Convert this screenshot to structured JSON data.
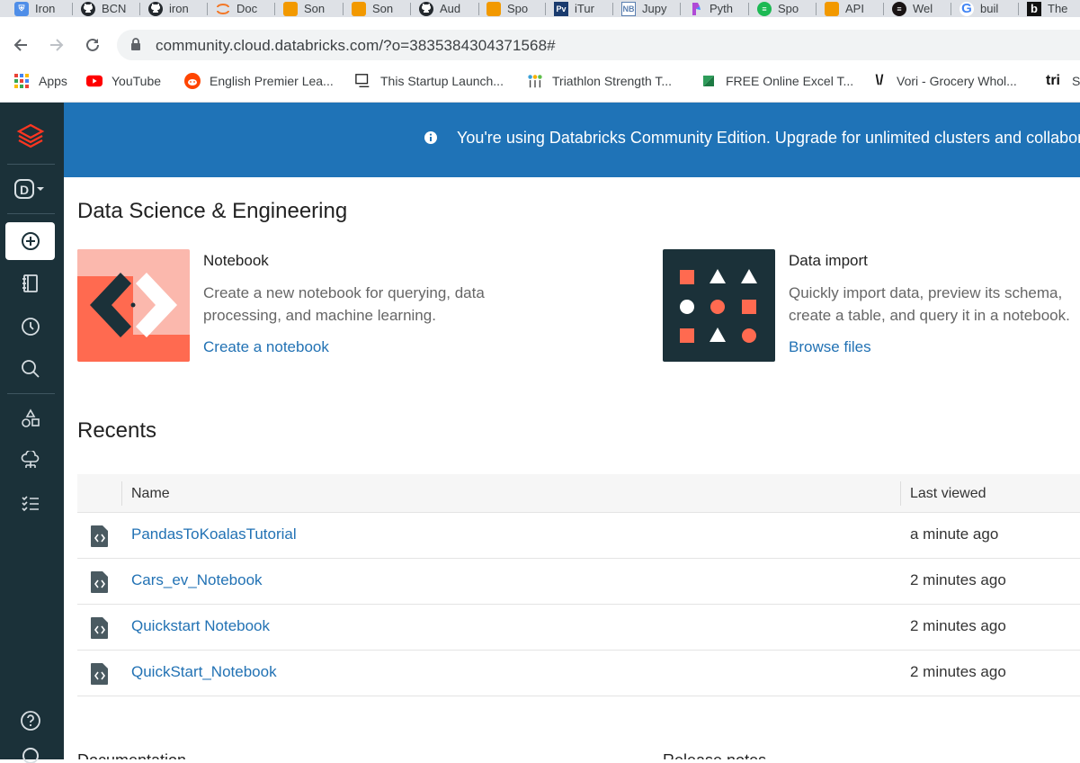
{
  "browser": {
    "tabs": [
      {
        "label": "Iron",
        "icon": "ironhack-icon",
        "color": "#4f8ee8"
      },
      {
        "label": "BCN",
        "icon": "github-icon",
        "color": "#24292e"
      },
      {
        "label": "iron",
        "icon": "github-icon",
        "color": "#24292e"
      },
      {
        "label": "Doc",
        "icon": "jupyter-icon",
        "color": "#f37726"
      },
      {
        "label": "Son",
        "icon": "bookmark-orange-icon",
        "color": "#f29900"
      },
      {
        "label": "Son",
        "icon": "bookmark-orange-icon",
        "color": "#f29900"
      },
      {
        "label": "Aud",
        "icon": "github-icon",
        "color": "#24292e"
      },
      {
        "label": "Spo",
        "icon": "bookmark-orange-icon",
        "color": "#f29900"
      },
      {
        "label": "iTur",
        "icon": "pv-icon",
        "color": "#1a3b6e"
      },
      {
        "label": "Jupy",
        "icon": "nb-icon",
        "color": "#5a7fb0"
      },
      {
        "label": "Pyth",
        "icon": "pycharm-icon",
        "color": "#9c27b0"
      },
      {
        "label": "Spo",
        "icon": "spotify-icon",
        "color": "#1db954"
      },
      {
        "label": "API",
        "icon": "bookmark-orange-icon",
        "color": "#f29900"
      },
      {
        "label": "Wel",
        "icon": "spotify-dark-icon",
        "color": "#191414"
      },
      {
        "label": "buil",
        "icon": "google-icon",
        "color": "#4285f4"
      },
      {
        "label": "The",
        "icon": "b-icon",
        "color": "#111111"
      }
    ],
    "url": "community.cloud.databricks.com/?o=3835384304371568#",
    "bookmarks": [
      {
        "label": "Apps",
        "icon": "apps-grid-icon"
      },
      {
        "label": "YouTube",
        "icon": "youtube-icon"
      },
      {
        "label": "English Premier Lea...",
        "icon": "reddit-icon"
      },
      {
        "label": "This Startup Launch...",
        "icon": "startup-icon"
      },
      {
        "label": "Triathlon Strength T...",
        "icon": "triathlon-icon"
      },
      {
        "label": "FREE Online Excel T...",
        "icon": "excel-icon"
      },
      {
        "label": "Vori - Grocery Whol...",
        "icon": "vori-icon"
      },
      {
        "label": "Su",
        "icon": "tri-icon"
      }
    ]
  },
  "banner": {
    "text": "You're using Databricks Community Edition. Upgrade for unlimited clusters and collaborati"
  },
  "main": {
    "section_title": "Data Science & Engineering",
    "cards": [
      {
        "title": "Notebook",
        "description": "Create a new notebook for querying, data processing, and machine learning.",
        "link": "Create a notebook"
      },
      {
        "title": "Data import",
        "description": "Quickly import data, preview its schema, create a table, and query it in a notebook.",
        "link": "Browse files"
      }
    ],
    "recents_title": "Recents",
    "recents_columns": {
      "name": "Name",
      "last_viewed": "Last viewed"
    },
    "recents": [
      {
        "name": "PandasToKoalasTutorial",
        "last_viewed": "a minute ago"
      },
      {
        "name": "Cars_ev_Notebook",
        "last_viewed": "2 minutes ago"
      },
      {
        "name": "Quickstart Notebook",
        "last_viewed": "2 minutes ago"
      },
      {
        "name": "QuickStart_Notebook",
        "last_viewed": "2 minutes ago"
      }
    ],
    "footer_left": "Documentation",
    "footer_right": "Release notes"
  },
  "colors": {
    "banner": "#1f73b7",
    "sidebar": "#1b3139",
    "link": "#2272b4",
    "brand_orange": "#ff5f46"
  }
}
